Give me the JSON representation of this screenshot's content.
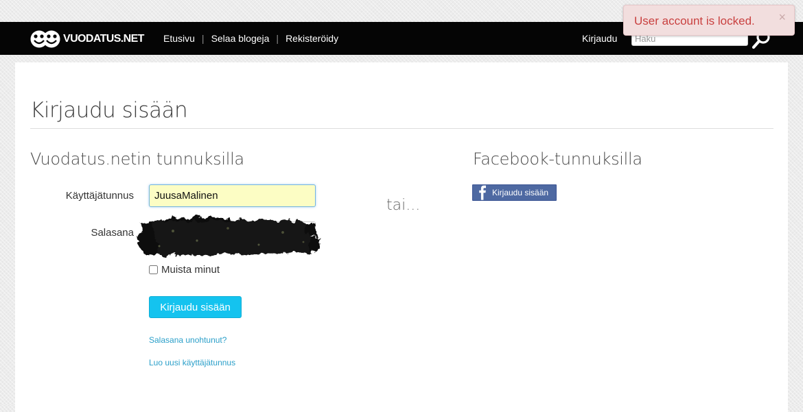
{
  "alert": {
    "message": "User account is locked.",
    "close_label": "×",
    "color": "#c9403f",
    "background": "#f2dede"
  },
  "navbar": {
    "brand": "VUODATUS.NET",
    "links": [
      "Etusivu",
      "Selaa blogeja",
      "Rekisteröidy"
    ],
    "separator": "|",
    "login_link": "Kirjaudu",
    "search": {
      "placeholder": "Haku",
      "icon": "search-icon"
    },
    "background": "#050505"
  },
  "page": {
    "title": "Kirjaudu sisään"
  },
  "local_login": {
    "heading": "Vuodatus.netin tunnuksilla",
    "username_label": "Käyttäjätunnus",
    "username_value": "JuusaMalinen",
    "password_label": "Salasana",
    "remember_label": "Muista minut",
    "remember_checked": false,
    "submit_label": "Kirjaudu sisään",
    "forgot_link": "Salasana unohtunut?",
    "create_link": "Luo uusi käyttäjätunnus",
    "accent": "#14c3ef",
    "link_color": "#2a9fc9"
  },
  "divider_text": "tai...",
  "facebook_login": {
    "heading": "Facebook-tunnuksilla",
    "button_label": "Kirjaudu sisään",
    "icon": "facebook-icon",
    "color": "#4e69a2"
  }
}
